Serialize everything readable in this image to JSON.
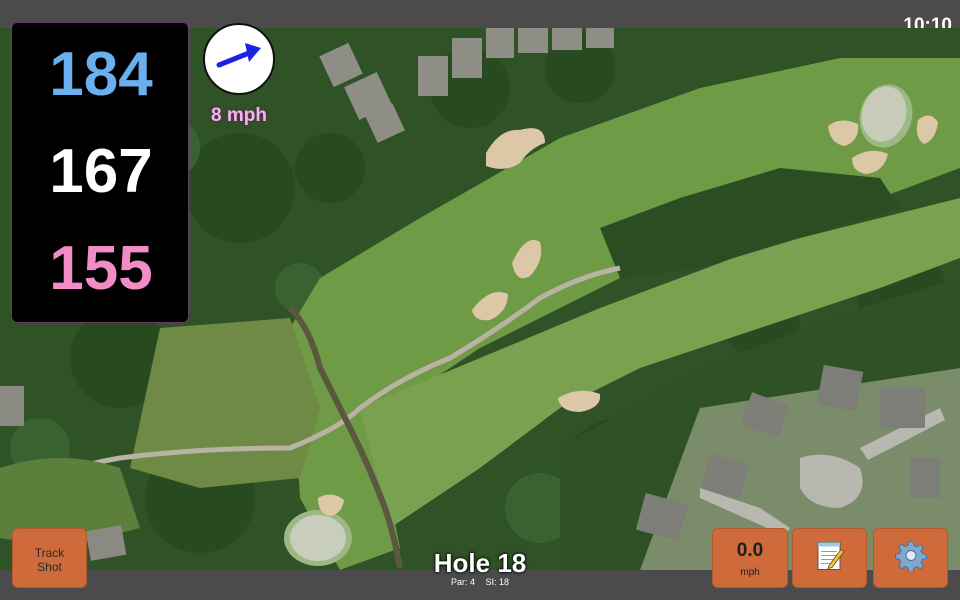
{
  "status_bar": {
    "time": "10:10"
  },
  "yardages": {
    "back": "184",
    "middle": "167",
    "front": "155"
  },
  "wind": {
    "speed": "8 mph",
    "direction_icon": "arrow-right-icon"
  },
  "buttons": {
    "track_shot": [
      "Track",
      "Shot"
    ],
    "speed_value": "0.0",
    "speed_unit": "mph",
    "notes_icon": "notepad-icon",
    "settings_icon": "gear-icon"
  },
  "hole": {
    "title": "Hole 18",
    "par": "Par: 4",
    "si": "SI: 18"
  },
  "colors": {
    "back_yardage": "#6ab0f0",
    "middle_yardage": "#ffffff",
    "front_yardage": "#f28cc6",
    "button_bg": "#cf6a3a",
    "panel_bg": "#000000"
  }
}
